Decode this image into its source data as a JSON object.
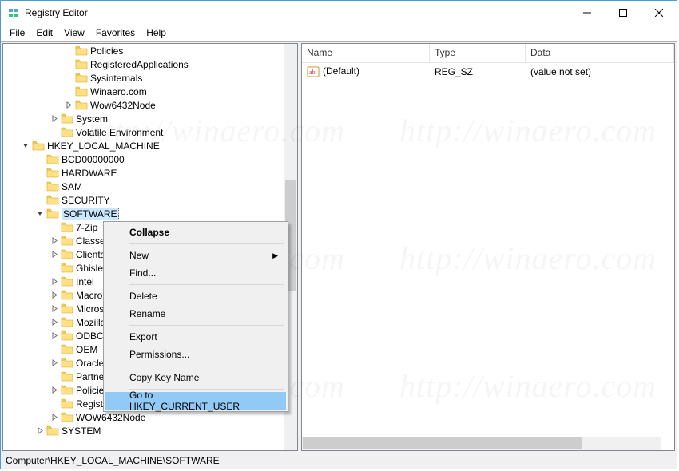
{
  "window": {
    "title": "Registry Editor"
  },
  "menu": {
    "file": "File",
    "edit": "Edit",
    "view": "View",
    "favorites": "Favorites",
    "help": "Help"
  },
  "tree": {
    "items": [
      {
        "indent": 4,
        "toggle": "none",
        "label": "Policies"
      },
      {
        "indent": 4,
        "toggle": "none",
        "label": "RegisteredApplications"
      },
      {
        "indent": 4,
        "toggle": "none",
        "label": "Sysinternals"
      },
      {
        "indent": 4,
        "toggle": "none",
        "label": "Winaero.com"
      },
      {
        "indent": 4,
        "toggle": "closed",
        "label": "Wow6432Node"
      },
      {
        "indent": 3,
        "toggle": "closed",
        "label": "System"
      },
      {
        "indent": 3,
        "toggle": "none",
        "label": "Volatile Environment"
      },
      {
        "indent": 1,
        "toggle": "open",
        "label": "HKEY_LOCAL_MACHINE"
      },
      {
        "indent": 2,
        "toggle": "none",
        "label": "BCD00000000"
      },
      {
        "indent": 2,
        "toggle": "none",
        "label": "HARDWARE"
      },
      {
        "indent": 2,
        "toggle": "none",
        "label": "SAM"
      },
      {
        "indent": 2,
        "toggle": "none",
        "label": "SECURITY"
      },
      {
        "indent": 2,
        "toggle": "open",
        "label": "SOFTWARE",
        "selected": true
      },
      {
        "indent": 3,
        "toggle": "none",
        "label": "7-Zip"
      },
      {
        "indent": 3,
        "toggle": "closed",
        "label": "Classes"
      },
      {
        "indent": 3,
        "toggle": "closed",
        "label": "Clients"
      },
      {
        "indent": 3,
        "toggle": "none",
        "label": "Ghisler"
      },
      {
        "indent": 3,
        "toggle": "closed",
        "label": "Intel"
      },
      {
        "indent": 3,
        "toggle": "closed",
        "label": "Macromedia"
      },
      {
        "indent": 3,
        "toggle": "closed",
        "label": "Microsoft"
      },
      {
        "indent": 3,
        "toggle": "closed",
        "label": "Mozilla"
      },
      {
        "indent": 3,
        "toggle": "closed",
        "label": "ODBC"
      },
      {
        "indent": 3,
        "toggle": "none",
        "label": "OEM"
      },
      {
        "indent": 3,
        "toggle": "closed",
        "label": "Oracle"
      },
      {
        "indent": 3,
        "toggle": "none",
        "label": "Partner"
      },
      {
        "indent": 3,
        "toggle": "closed",
        "label": "Policies"
      },
      {
        "indent": 3,
        "toggle": "none",
        "label": "RegisteredApplications"
      },
      {
        "indent": 3,
        "toggle": "closed",
        "label": "WOW6432Node"
      },
      {
        "indent": 2,
        "toggle": "closed",
        "label": "SYSTEM"
      }
    ]
  },
  "list": {
    "columns": {
      "name": "Name",
      "type": "Type",
      "data": "Data"
    },
    "rows": [
      {
        "name": "(Default)",
        "type": "REG_SZ",
        "data": "(value not set)"
      }
    ]
  },
  "context": {
    "collapse": "Collapse",
    "new": "New",
    "find": "Find...",
    "delete": "Delete",
    "rename": "Rename",
    "export": "Export",
    "permissions": "Permissions...",
    "copy_key": "Copy Key Name",
    "goto": "Go to HKEY_CURRENT_USER"
  },
  "status": {
    "path": "Computer\\HKEY_LOCAL_MACHINE\\SOFTWARE"
  },
  "watermark": "http://winaero.com"
}
